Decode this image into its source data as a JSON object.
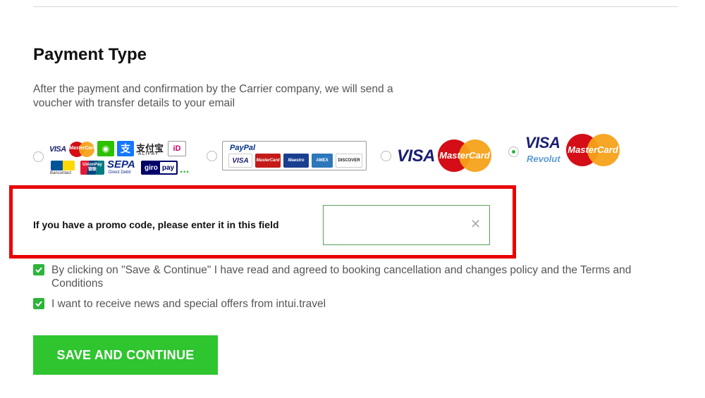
{
  "page": {
    "section_title": "Payment Type",
    "description": "After the payment and confirmation by the Carrier company, we will send a voucher with transfer details to your email"
  },
  "payment_options": [
    {
      "id": "multi",
      "selected": false,
      "logos": {
        "visa": "VISA",
        "mastercard": "MasterCard",
        "alipay_cn": "支付宝",
        "alipay": "ALIPAY",
        "ideal": "iD",
        "bancontact": "Bancontact",
        "unionpay": "UnionPay",
        "unionpay_cn": "银联",
        "sepa": "SEPA",
        "sepa_sub": "Direct Debit",
        "giropay_a": "giro",
        "giropay_b": "pay",
        "more": "..."
      }
    },
    {
      "id": "paypal",
      "selected": false,
      "logos": {
        "paypal": "PayPal",
        "visa": "VISA",
        "mastercard": "MasterCard",
        "maestro": "Maestro",
        "amex": "AMEX",
        "discover": "DISCOVER"
      }
    },
    {
      "id": "card",
      "selected": false,
      "logos": {
        "visa": "VISA",
        "mastercard": "MasterCard"
      }
    },
    {
      "id": "revolut",
      "selected": true,
      "logos": {
        "visa": "VISA",
        "revolut": "Revolut",
        "mastercard": "MasterCard"
      }
    }
  ],
  "promo": {
    "label": "If you have a promo code, please enter it in this field",
    "value": "",
    "clear_glyph": "✕"
  },
  "agreements": [
    {
      "checked": true,
      "text": "By clicking on \"Save & Continue\" I have read and agreed to booking cancellation and changes policy and the Terms and Conditions"
    },
    {
      "checked": true,
      "text": "I want to receive news and special offers from intui.travel"
    }
  ],
  "submit": {
    "label": "SAVE AND CONTINUE"
  },
  "colors": {
    "accent_green": "#2ec52f",
    "highlight_red": "#ea0000",
    "visa_blue": "#1a1f71",
    "mc_red": "#d40d16",
    "mc_orange": "#f5a21a"
  }
}
